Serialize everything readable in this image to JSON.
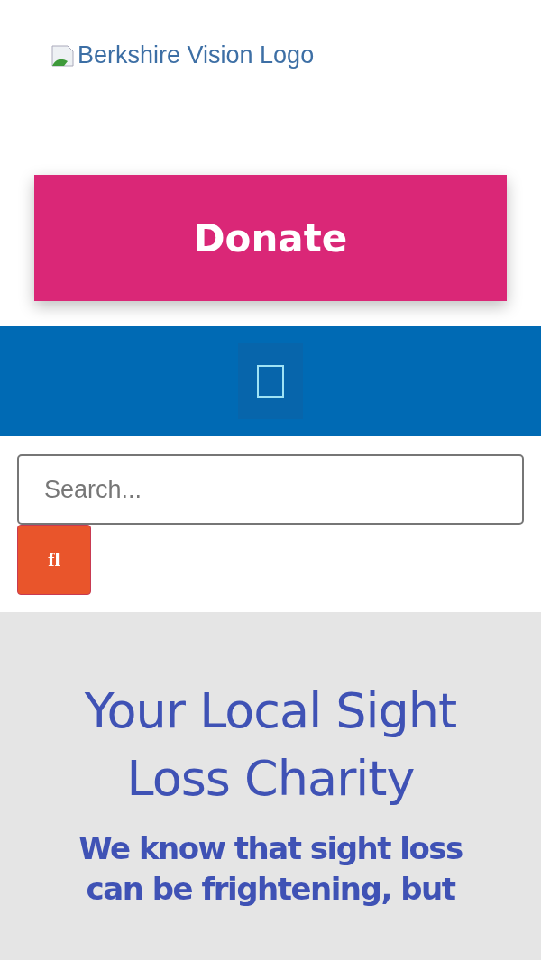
{
  "logo": {
    "alt_text": "Berkshire Vision Logo"
  },
  "donate_button": {
    "label": "Donate"
  },
  "nav": {
    "menu_button": {
      "kind": "missing-glyph"
    }
  },
  "search": {
    "placeholder": "Search...",
    "button_label": "fl"
  },
  "hero": {
    "title": "Your Local Sight Loss Charity",
    "subtitle": "We know that sight loss can be frightening, but"
  }
}
